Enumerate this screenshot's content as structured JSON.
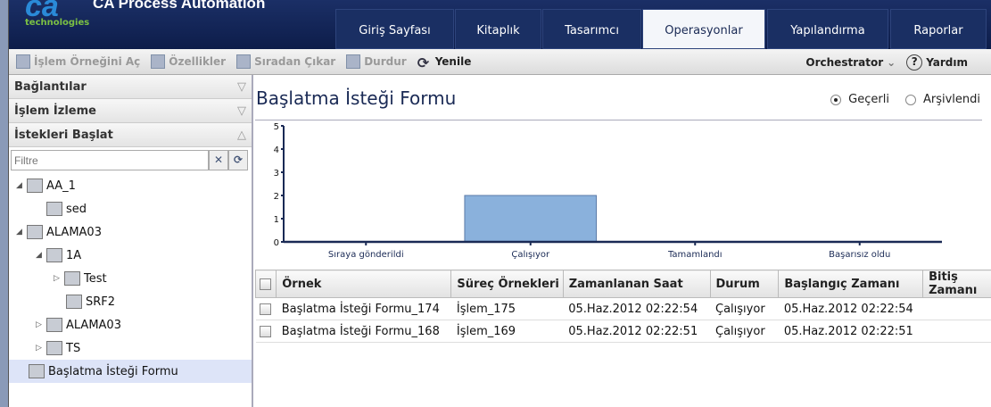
{
  "app": {
    "logo": "ca",
    "logo_sub": "technologies",
    "title": "CA Process Automation"
  },
  "tabs": [
    {
      "label": "Giriş Sayfası"
    },
    {
      "label": "Kitaplık"
    },
    {
      "label": "Tasarımcı"
    },
    {
      "label": "Operasyonlar"
    },
    {
      "label": "Yapılandırma"
    },
    {
      "label": "Raporlar"
    }
  ],
  "toolbar": {
    "open": "İşlem Örneğini Aç",
    "props": "Özellikler",
    "dequeue": "Sıradan Çıkar",
    "stop": "Durdur",
    "refresh": "Yenile",
    "orchestrator": "Orchestrator",
    "help": "Yardım"
  },
  "left": {
    "connections": "Bağlantılar",
    "monitoring": "İşlem İzleme",
    "start_requests": "İstekleri Başlat",
    "filter_placeholder": "Filtre",
    "tree": [
      {
        "label": "AA_1"
      },
      {
        "label": "sed"
      },
      {
        "label": "ALAMA03"
      },
      {
        "label": "1A"
      },
      {
        "label": "Test"
      },
      {
        "label": "SRF2"
      },
      {
        "label": "ALAMA03"
      },
      {
        "label": "TS"
      },
      {
        "label": "Başlatma İsteği Formu"
      }
    ]
  },
  "main": {
    "title": "Başlatma İsteği Formu",
    "radio_current": "Geçerli",
    "radio_archived": "Arşivlendi"
  },
  "chart_data": {
    "type": "bar",
    "categories": [
      "Sıraya gönderildi",
      "Çalışıyor",
      "Tamamlandı",
      "Başarısız oldu"
    ],
    "values": [
      0,
      2,
      0,
      0
    ],
    "ylim": [
      0,
      5
    ],
    "yticks": [
      "0",
      "1",
      "2",
      "3",
      "4",
      "5"
    ],
    "color": "#8ab1dc"
  },
  "table": {
    "headers": [
      "Örnek",
      "Süreç Örnekleri",
      "Zamanlanan Saat",
      "Durum",
      "Başlangıç Zamanı",
      "Bitiş Zamanı"
    ],
    "rows": [
      [
        "Başlatma İsteği Formu_174",
        "İşlem_175",
        "05.Haz.2012 02:22:54",
        "Çalışıyor",
        "05.Haz.2012 02:22:54",
        ""
      ],
      [
        "Başlatma İsteği Formu_168",
        "İşlem_169",
        "05.Haz.2012 02:22:51",
        "Çalışıyor",
        "05.Haz.2012 02:22:51",
        ""
      ]
    ]
  }
}
